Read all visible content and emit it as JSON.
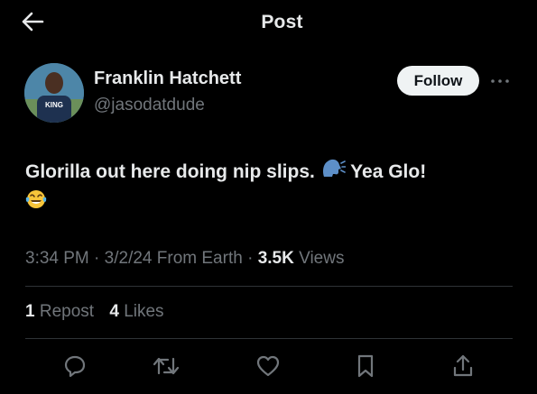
{
  "header": {
    "title": "Post",
    "back_icon": "arrow-left-icon"
  },
  "author": {
    "name": "Franklin Hatchett",
    "handle": "@jasodatdude",
    "avatar_shirt_text": "KING",
    "follow_label": "Follow"
  },
  "tweet": {
    "text": "Glorilla out here doing nip slips.",
    "text_after_emoji": "Yea Glo!",
    "emoji_1": "speaking-head-emoji",
    "emoji_2": "face-with-tears-of-joy-emoji"
  },
  "meta": {
    "time": "3:34 PM",
    "date": "3/2/24",
    "location": "From Earth",
    "views_count": "3.5K",
    "views_label": "Views",
    "sep": "·"
  },
  "stats": {
    "reposts_count": "1",
    "reposts_label": "Repost",
    "likes_count": "4",
    "likes_label": "Likes"
  },
  "actions": [
    "reply-icon",
    "repost-icon",
    "like-icon",
    "bookmark-icon",
    "share-icon"
  ],
  "colors": {
    "background": "#000000",
    "text": "#e7e9ea",
    "muted": "#71767b",
    "divider": "#2f3336",
    "follow_bg": "#eff3f4"
  }
}
